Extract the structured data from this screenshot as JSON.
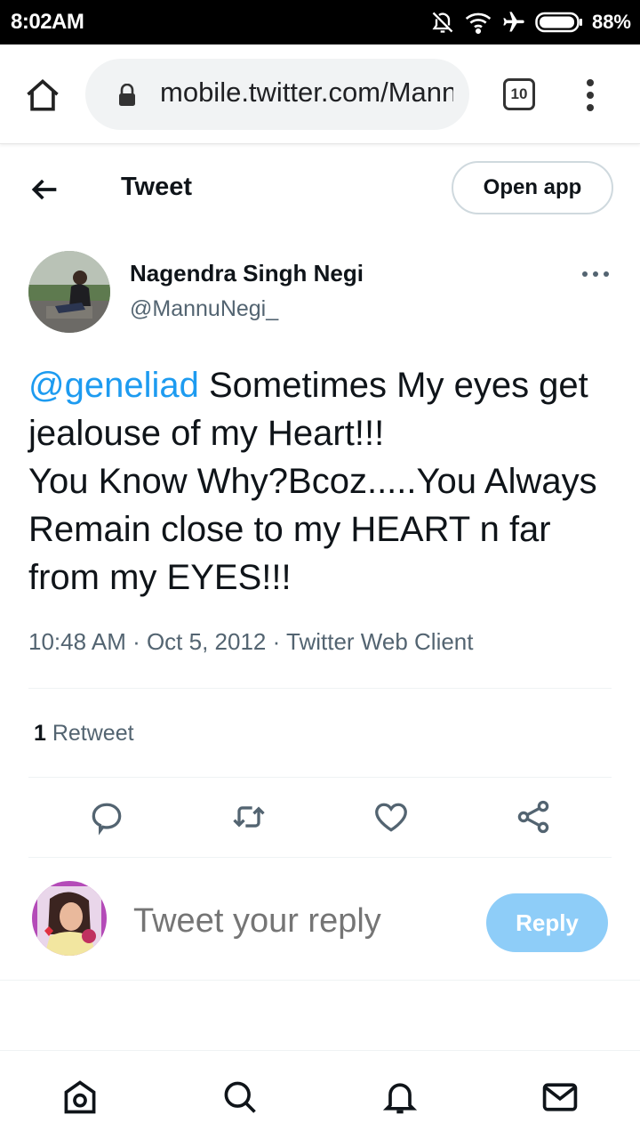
{
  "status_bar": {
    "time": "8:02AM",
    "battery": "88%"
  },
  "browser": {
    "url": "mobile.twitter.com/MannuNegi_/status",
    "tab_count": "10"
  },
  "header": {
    "title": "Tweet",
    "open_app_label": "Open app"
  },
  "tweet": {
    "author_name": "Nagendra Singh Negi",
    "author_handle": "@MannuNegi_",
    "mention": "@geneliad",
    "body": " Sometimes My eyes get jealouse of my Heart!!!\n You Know Why?Bcoz.....You Always Remain close to my HEART n far from my EYES!!!",
    "meta": "10:48 AM · Oct 5, 2012 · Twitter Web Client",
    "retweet_count": "1",
    "retweet_label": " Retweet"
  },
  "reply": {
    "placeholder": "Tweet your reply",
    "button_label": "Reply"
  },
  "icons": {
    "actions": [
      "reply-icon",
      "retweet-icon",
      "like-icon",
      "share-icon"
    ],
    "nav": [
      "home-icon",
      "search-icon",
      "notifications-icon",
      "messages-icon"
    ]
  },
  "colors": {
    "accent": "#1d9bf0",
    "reply_button": "#8ecdf8",
    "secondary_text": "#536471"
  }
}
